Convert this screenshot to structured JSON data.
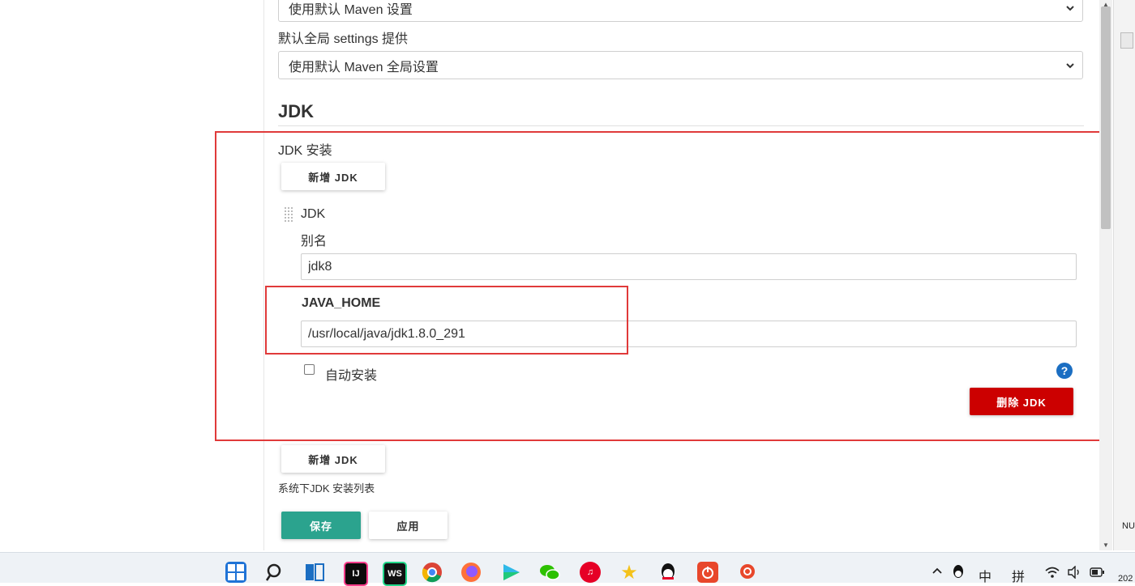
{
  "maven": {
    "settings_select": "使用默认 Maven 设置",
    "global_label": "默认全局 settings 提供",
    "global_select": "使用默认 Maven 全局设置"
  },
  "jdk": {
    "section_title": "JDK",
    "install_label": "JDK 安装",
    "add_button": "新增 JDK",
    "item_title": "JDK",
    "alias_label": "别名",
    "alias_value": "jdk8",
    "java_home_label": "JAVA_HOME",
    "java_home_value": "/usr/local/java/jdk1.8.0_291",
    "auto_install_label": "自动安装",
    "delete_button": "删除 JDK",
    "add_button_bottom": "新增 JDK",
    "list_hint": "系统下JDK 安装列表"
  },
  "actions": {
    "save": "保存",
    "apply": "应用"
  },
  "help_glyph": "?",
  "side_strip_text": "NU",
  "taskbar": {
    "ime_lang": "中",
    "ime_mode": "拼",
    "clock_fragment": "202",
    "icons": [
      "windows-start-icon",
      "search-icon",
      "task-view-icon",
      "intellij-idea-icon",
      "webstorm-icon",
      "chrome-icon",
      "firefox-icon",
      "media-player-icon",
      "wechat-icon",
      "netease-music-icon",
      "star-app-icon",
      "qq-icon",
      "power-app-icon",
      "snail-app-icon"
    ]
  },
  "colors": {
    "accent_green": "#2ba38e",
    "danger_red": "#cc0000",
    "annotation_red": "#e03a3a",
    "help_blue": "#1b6ec2"
  }
}
